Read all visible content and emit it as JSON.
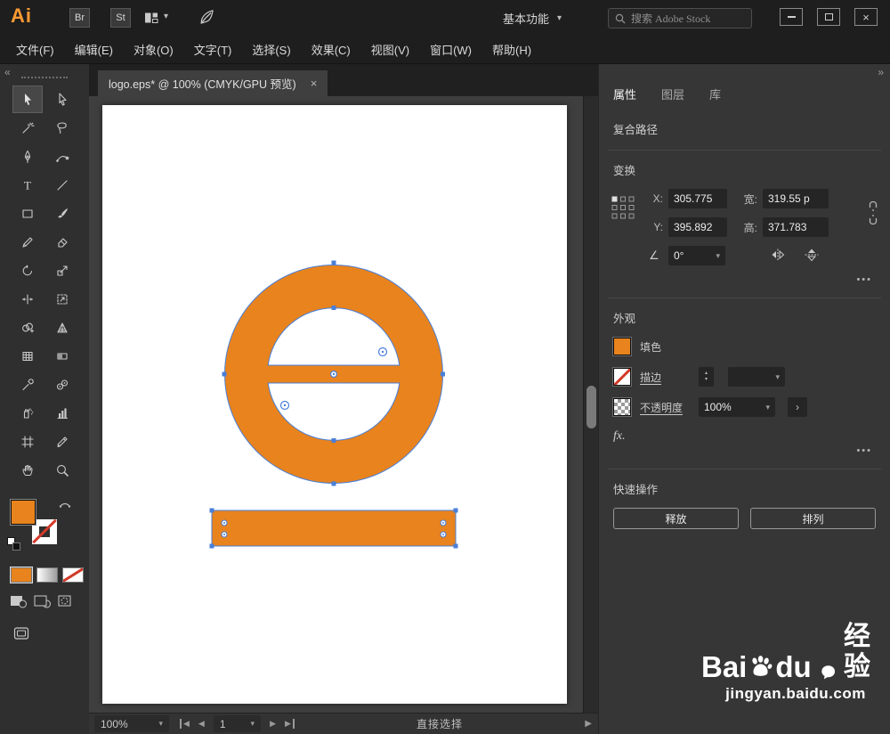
{
  "colors": {
    "accent": "#E8831D",
    "selection": "#4A7FD8"
  },
  "titlebar": {
    "app": "Ai",
    "bridge": "Br",
    "stock": "St",
    "workspace": "基本功能",
    "search_placeholder": "搜索 Adobe Stock"
  },
  "menubar": {
    "items": [
      {
        "label": "文件(F)"
      },
      {
        "label": "编辑(E)"
      },
      {
        "label": "对象(O)"
      },
      {
        "label": "文字(T)"
      },
      {
        "label": "选择(S)"
      },
      {
        "label": "效果(C)"
      },
      {
        "label": "视图(V)"
      },
      {
        "label": "窗口(W)"
      },
      {
        "label": "帮助(H)"
      }
    ]
  },
  "document": {
    "tab_title": "logo.eps* @ 100% (CMYK/GPU 预览)"
  },
  "tools": {
    "names": [
      "selection",
      "direct-selection",
      "magic-wand",
      "lasso",
      "pen",
      "curvature",
      "type",
      "line-segment",
      "rectangle",
      "paintbrush",
      "pencil",
      "eraser",
      "rotate",
      "scale",
      "width",
      "free-transform",
      "shape-builder",
      "perspective-grid",
      "mesh",
      "gradient",
      "eyedropper",
      "blend",
      "symbol-sprayer",
      "column-graph",
      "artboard",
      "slice",
      "hand",
      "zoom"
    ]
  },
  "panel": {
    "tabs": [
      {
        "label": "属性"
      },
      {
        "label": "图层"
      },
      {
        "label": "库"
      }
    ],
    "selection_type": "复合路径",
    "transform": {
      "title": "变换",
      "x_label": "X:",
      "x": "305.775",
      "y_label": "Y:",
      "y": "395.892",
      "w_label": "宽:",
      "w": "319.55 p",
      "h_label": "高:",
      "h": "371.783",
      "angle": "0°"
    },
    "appearance": {
      "title": "外观",
      "fill": "填色",
      "stroke": "描边",
      "opacity_label": "不透明度",
      "opacity": "100%",
      "fx": "fx."
    },
    "quick": {
      "title": "快速操作",
      "release": "释放",
      "arrange": "排列"
    }
  },
  "statusbar": {
    "zoom": "100%",
    "artboard": "1",
    "tool": "直接选择"
  },
  "watermark": {
    "bai": "Bai",
    "du": "du",
    "brand": "经验",
    "url": "jingyan.baidu.com"
  },
  "icons": {
    "chevron_down": "▾",
    "up_small": "▴",
    "down_small": "▾",
    "chevron_right": "›",
    "left": "◀",
    "right": "▶",
    "close": "×",
    "more": "•••",
    "collapse_left": "«",
    "collapse_right": "»",
    "angle": "∠",
    "type_glyph": "T"
  }
}
